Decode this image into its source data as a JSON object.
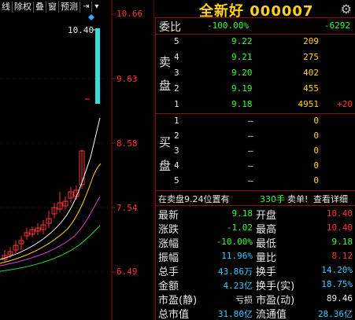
{
  "toolbar": {
    "items": [
      "线",
      "除权",
      "叠",
      "窗",
      "预测"
    ],
    "icon_play": "⇥",
    "icon_dropdown": "▾"
  },
  "chart": {
    "price_ticks": [
      "10.66",
      "9.63",
      "8.58",
      "7.54",
      "6.49"
    ],
    "high_label": "10.40",
    "ma_colors": [
      "#ffffff",
      "#ffd21a",
      "#d040d0",
      "#33dd33"
    ],
    "up_color": "#ff3333",
    "down_color": "#33dddd"
  },
  "header": {
    "name": "全新好",
    "code": "000007",
    "settings_icon": "gear-icon"
  },
  "weibi": {
    "label": "委比",
    "value": "-100.00%",
    "diff": "-6292"
  },
  "sell_label": [
    "卖",
    "盘"
  ],
  "buy_label": [
    "买",
    "盘"
  ],
  "sell": [
    {
      "level": "5",
      "price": "9.22",
      "volume": "209",
      "change": ""
    },
    {
      "level": "4",
      "price": "9.21",
      "volume": "275",
      "change": ""
    },
    {
      "level": "3",
      "price": "9.20",
      "volume": "402",
      "change": ""
    },
    {
      "level": "2",
      "price": "9.19",
      "volume": "455",
      "change": ""
    },
    {
      "level": "1",
      "price": "9.18",
      "volume": "4951",
      "change": "+20"
    }
  ],
  "buy": [
    {
      "level": "1",
      "price": "–",
      "volume": "0"
    },
    {
      "level": "2",
      "price": "–",
      "volume": "0"
    },
    {
      "level": "3",
      "price": "–",
      "volume": "0"
    },
    {
      "level": "4",
      "price": "–",
      "volume": "0"
    },
    {
      "level": "5",
      "price": "–",
      "volume": "0"
    }
  ],
  "notice": {
    "text": "在卖盘9.24位置有",
    "amount": "330手",
    "action": "卖单!",
    "link": "查看详细"
  },
  "stats": [
    {
      "l1": "最新",
      "v1": "9.18",
      "c1": "green",
      "l2": "开盘",
      "v2": "10.40",
      "c2": "red"
    },
    {
      "l1": "涨跌",
      "v1": "-1.02",
      "c1": "green",
      "l2": "最高",
      "v2": "10.40",
      "c2": "red"
    },
    {
      "l1": "涨幅",
      "v1": "-10.00%",
      "c1": "green",
      "l2": "最低",
      "v2": "9.18",
      "c2": "green"
    },
    {
      "l1": "振幅",
      "v1": "11.96%",
      "c1": "cyan",
      "l2": "量比",
      "v2": "8.12",
      "c2": "red"
    },
    {
      "l1": "总手",
      "v1": "43.86万",
      "c1": "cyan",
      "l2": "换手",
      "v2": "14.20%",
      "c2": "cyan"
    },
    {
      "l1": "金额",
      "v1": "4.23亿",
      "c1": "cyan",
      "l2": "换手(实)",
      "v2": "18.75%",
      "c2": "cyan"
    },
    {
      "l1": "市盈(静)",
      "v1": "亏损",
      "c1": "white",
      "l2": "市盈(动)",
      "v2": "89.46",
      "c2": "white"
    },
    {
      "l1": "总市值",
      "v1": "31.80亿",
      "c1": "cyan",
      "l2": "流通值",
      "v2": "28.36亿",
      "c2": "cyan"
    }
  ]
}
